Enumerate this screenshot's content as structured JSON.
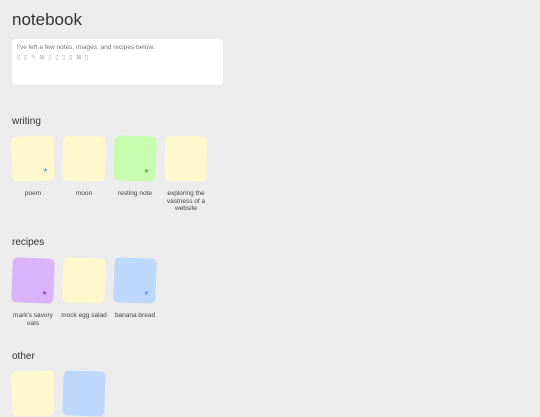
{
  "header": {
    "title": "notebook"
  },
  "intro": {
    "text": "I've left a few notes, images, and recipes below.",
    "glyphs": "▯ ▯ ✎ ⊞ ▯ ▯ ▯ ▯ ⊠ ▯"
  },
  "sections": [
    {
      "title": "writing",
      "notes": [
        {
          "label": "poem",
          "color": "#fff8cd",
          "star": "*",
          "star_color": "#4a90e2"
        },
        {
          "label": "moon",
          "color": "#fff8cd",
          "star": "",
          "star_color": ""
        },
        {
          "label": "resting note",
          "color": "#c6fbb0",
          "star": "*",
          "star_color": "#3a8f3a"
        },
        {
          "label": "exploring the vastness of a website",
          "color": "#fff8cd",
          "star": "",
          "star_color": ""
        }
      ]
    },
    {
      "title": "recipes",
      "notes": [
        {
          "label": "mark's savory oats",
          "color": "#dab4fa",
          "star": "*",
          "star_color": "#7a2f9a"
        },
        {
          "label": "mock egg salad",
          "color": "#fff8cd",
          "star": "",
          "star_color": ""
        },
        {
          "label": "banana bread",
          "color": "#bdd8fb",
          "star": "*",
          "star_color": "#4a90e2"
        }
      ]
    },
    {
      "title": "other",
      "notes": [
        {
          "label": "",
          "color": "#fff8cd",
          "star": "",
          "star_color": ""
        },
        {
          "label": "",
          "color": "#bdd8fb",
          "star": "",
          "star_color": ""
        }
      ]
    }
  ]
}
